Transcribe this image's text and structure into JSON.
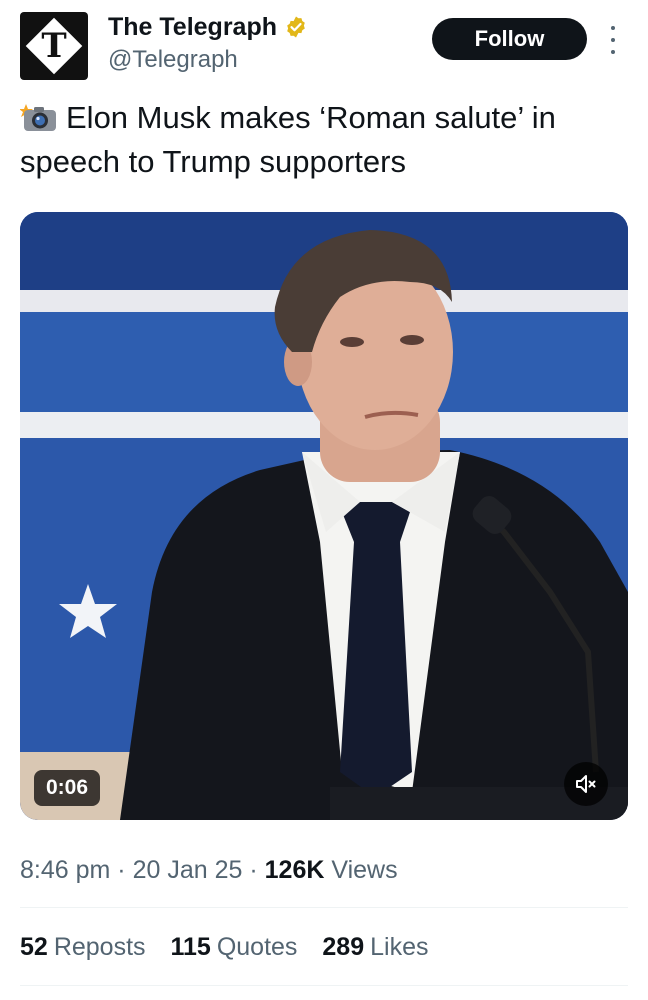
{
  "account": {
    "display_name": "The Telegraph",
    "handle": "@Telegraph",
    "avatar_letter": "T",
    "verified_color": "#e2b719"
  },
  "follow_button": {
    "label": "Follow"
  },
  "tweet": {
    "emoji_icon": "camera-flash-icon",
    "text": "Elon Musk makes ‘Roman salute’ in speech to Trump supporters"
  },
  "video": {
    "duration": "0:06",
    "mute_icon": "speaker-muted-icon"
  },
  "meta": {
    "time": "8:46 pm",
    "date": "20 Jan 25",
    "views_count": "126K",
    "views_label": "Views",
    "separator": "·"
  },
  "stats": {
    "reposts_count": "52",
    "reposts_label": "Reposts",
    "quotes_count": "115",
    "quotes_label": "Quotes",
    "likes_count": "289",
    "likes_label": "Likes"
  },
  "colors": {
    "text_primary": "#0f1419",
    "text_secondary": "#536471",
    "button_bg": "#0f1419",
    "divider": "#eff3f4"
  }
}
